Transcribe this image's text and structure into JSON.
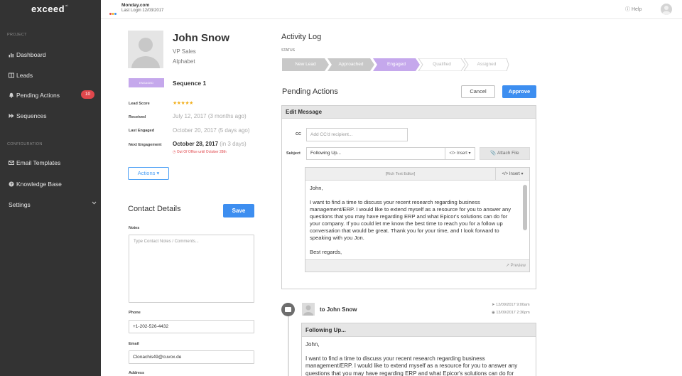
{
  "sidebar": {
    "logo": "exceed",
    "logo_sup": "ai",
    "section_project": "PROJECT",
    "section_configuration": "CONFIGURATION",
    "items": [
      {
        "label": "Dashboard",
        "icon": "bar-chart-icon"
      },
      {
        "label": "Leads",
        "icon": "contacts-icon"
      },
      {
        "label": "Pending Actions",
        "icon": "bell-icon",
        "badge": "10"
      },
      {
        "label": "Sequences",
        "icon": "fast-forward-icon"
      },
      {
        "label": "Email Templates",
        "icon": "envelope-icon"
      },
      {
        "label": "Knowledge Base",
        "icon": "question-circle-icon"
      },
      {
        "label": "Settings",
        "icon": "chevron-down-icon"
      }
    ]
  },
  "topbar": {
    "brand": "Monday.com",
    "last_login": "Last Login 12/03/2017",
    "help": "Help"
  },
  "profile": {
    "name": "John Snow",
    "title": "VP Sales",
    "company": "Alphabet",
    "tag": "ENGAGED",
    "sequence": "Sequence 1",
    "lead_score_label": "Lead Score",
    "lead_score": 5,
    "received_label": "Received",
    "received_date": "July 12, 2017",
    "received_rel": "(3 months ago)",
    "last_engaged_label": "Last Engaged",
    "last_engaged_date": "October 20, 2017",
    "last_engaged_rel": "(5 days ago)",
    "next_engagement_label": "Next Engagement",
    "next_engagement_date": "October 28, 2017",
    "next_engagement_rel": "(in 3 days)",
    "out_of_office": "Out Of Office until October 28th",
    "actions_label": "Actions"
  },
  "contact": {
    "title": "Contact Details",
    "save_label": "Save",
    "notes_label": "Notes",
    "notes_placeholder": "Type Contact Notes / Comments...",
    "phone_label": "Phone",
    "phone": "+1-202-526-4432",
    "email_label": "Email",
    "email": "Clonachis49@cuvox.de",
    "address_label": "Address"
  },
  "activity": {
    "title": "Activity Log",
    "status_label": "STATUS",
    "steps": [
      {
        "label": "New Lead",
        "state": "done"
      },
      {
        "label": "Approached",
        "state": "done"
      },
      {
        "label": "Engaged",
        "state": "active"
      },
      {
        "label": "Qualified",
        "state": "todo"
      },
      {
        "label": "Assigned",
        "state": "todo"
      }
    ]
  },
  "pending": {
    "title": "Pending Actions",
    "cancel_label": "Cancel",
    "approve_label": "Approve",
    "edit_header": "Edit Message",
    "cc_label": "CC",
    "cc_placeholder": "Add CC'd recipient...",
    "subject_label": "Subject",
    "subject_value": "Following Up...",
    "insert_label": "Insert",
    "attach_label": "Attach File",
    "rte_label": "[Rich Text Editor]",
    "greeting": "John,",
    "body": "I want to find a time to discuss your recent research regarding business management/ERP. I would like to extend myself as a resource for you to answer any questions that you may have regarding ERP and what Epicor's solutions can do for your company. If you could let me know the best time to reach you for a follow up conversation that would be great. Thank you for your time, and I look forward to speaking with you Jon.",
    "signoff": "Best regards,",
    "preview_label": "Preview"
  },
  "timeline": {
    "to_label": "to John Snow",
    "sent_time": "12/09/2017 9:00am",
    "viewed_time": "13/09/2017 2:36pm",
    "message_subject": "Following Up...",
    "greeting": "John,",
    "body": "I want to find a time to discuss your recent research regarding business management/ERP. I would like to extend myself as a resource for you to answer any questions that you may have regarding ERP and what Epicor's solutions can do for"
  },
  "colors": {
    "sidebar_bg": "#333333",
    "accent_blue": "#3d8ef0",
    "badge_red": "#e0474c",
    "engaged_purple": "#c5a8ec",
    "star_gold": "#f2b01e"
  }
}
